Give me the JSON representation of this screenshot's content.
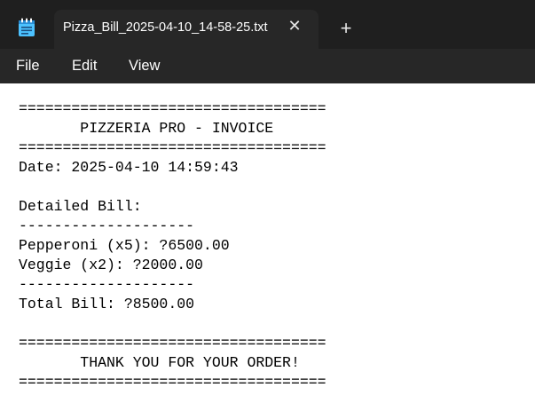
{
  "tab": {
    "title": "Pizza_Bill_2025-04-10_14-58-25.txt",
    "close_glyph": "✕",
    "new_tab_glyph": "+"
  },
  "menu": {
    "file": "File",
    "edit": "Edit",
    "view": "View"
  },
  "document": {
    "lines": [
      "===================================",
      "       PIZZERIA PRO - INVOICE",
      "===================================",
      "Date: 2025-04-10 14:59:43",
      "",
      "Detailed Bill:",
      "--------------------",
      "Pepperoni (x5): ?6500.00",
      "Veggie (x2): ?2000.00",
      "--------------------",
      "Total Bill: ?8500.00",
      "",
      "===================================",
      "       THANK YOU FOR YOUR ORDER!",
      "==================================="
    ]
  },
  "icons": {
    "app": "notepad-icon",
    "close": "close-icon",
    "new_tab": "plus-icon"
  },
  "colors": {
    "chrome": "#1f1f1f",
    "tab": "#272727",
    "editor_bg": "#ffffff",
    "icon_blue": "#4cc2ff"
  }
}
